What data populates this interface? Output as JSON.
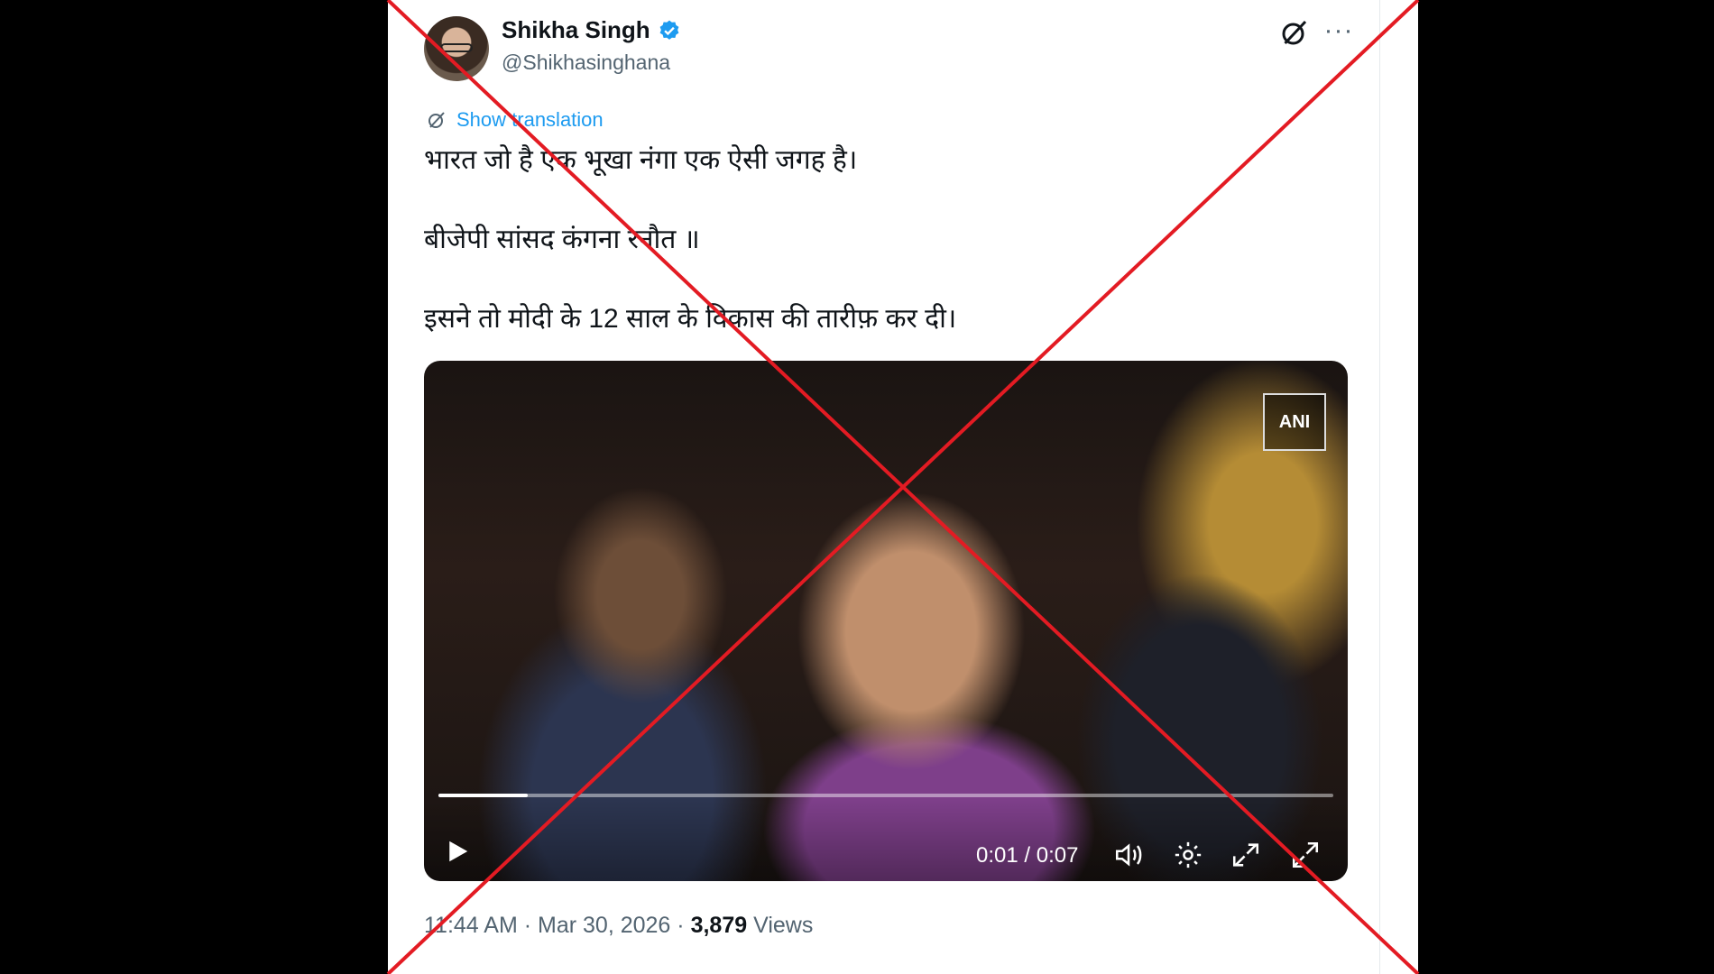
{
  "author": {
    "name": "Shikha Singh",
    "handle": "@Shikhasinghana"
  },
  "translate_label": "Show translation",
  "tweet_lines": [
    "भारत जो है एक भूखा नंगा एक ऐसी जगह है।",
    "बीजेपी सांसद कंगना रनौत ॥",
    "इसने तो मोदी के 12 साल के विकास की तारीफ़ कर दी।"
  ],
  "video": {
    "watermark": "ANI",
    "time": "0:01 / 0:07",
    "progress": 0.1
  },
  "meta": {
    "time": "11:44 AM",
    "date": "Mar 30, 2026",
    "views_count": "3,879",
    "views_label": "Views"
  },
  "colors": {
    "accent": "#1d9bf0",
    "cross": "#e31b23"
  },
  "icons": [
    "verified-icon",
    "grok-icon",
    "more-icon",
    "translate-icon",
    "play-icon",
    "volume-icon",
    "settings-icon",
    "pip-icon",
    "fullscreen-icon"
  ]
}
